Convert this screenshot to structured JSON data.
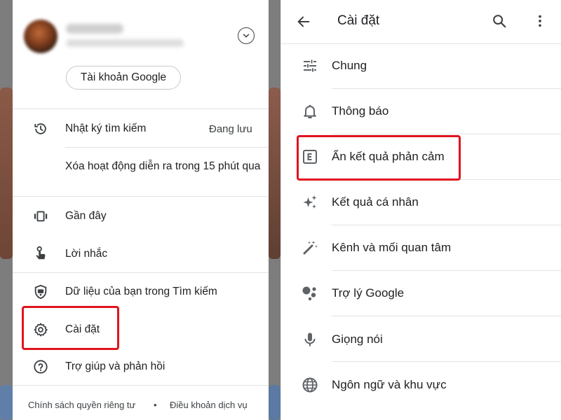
{
  "left_panel": {
    "account_button_label": "Tài khoản Google",
    "menu": {
      "history": {
        "label": "Nhật ký tìm kiếm",
        "status": "Đang lưu"
      },
      "delete_activity": {
        "label": "Xóa hoạt động diễn ra trong 15 phút qua"
      },
      "recent": {
        "label": "Gần đây"
      },
      "reminders": {
        "label": "Lời nhắc"
      },
      "your_data": {
        "label": "Dữ liệu của bạn trong Tìm kiếm"
      },
      "settings": {
        "label": "Cài đặt"
      },
      "help": {
        "label": "Trợ giúp và phản hồi"
      }
    },
    "footer": {
      "privacy": "Chính sách quyền riêng tư",
      "separator": "•",
      "terms": "Điều khoản dịch vụ"
    }
  },
  "right_panel": {
    "title": "Cài đặt",
    "items": [
      {
        "label": "Chung",
        "icon": "tune-sliders-icon"
      },
      {
        "label": "Thông báo",
        "icon": "bell-icon"
      },
      {
        "label": "Ẩn kết quả phản cảm",
        "icon": "explicit-e-icon"
      },
      {
        "label": "Kết quả cá nhân",
        "icon": "sparkle-icon"
      },
      {
        "label": "Kênh và mối quan tâm",
        "icon": "magic-wand-icon"
      },
      {
        "label": "Trợ lý Google",
        "icon": "assistant-dots-icon"
      },
      {
        "label": "Giọng nói",
        "icon": "microphone-icon"
      },
      {
        "label": "Ngôn ngữ và khu vực",
        "icon": "globe-icon"
      }
    ]
  },
  "colors": {
    "highlight": "#e0141e",
    "text": "#202124",
    "icon": "#5f6368",
    "divider": "#e3e3e3",
    "overlay": "#7d7d7d"
  }
}
